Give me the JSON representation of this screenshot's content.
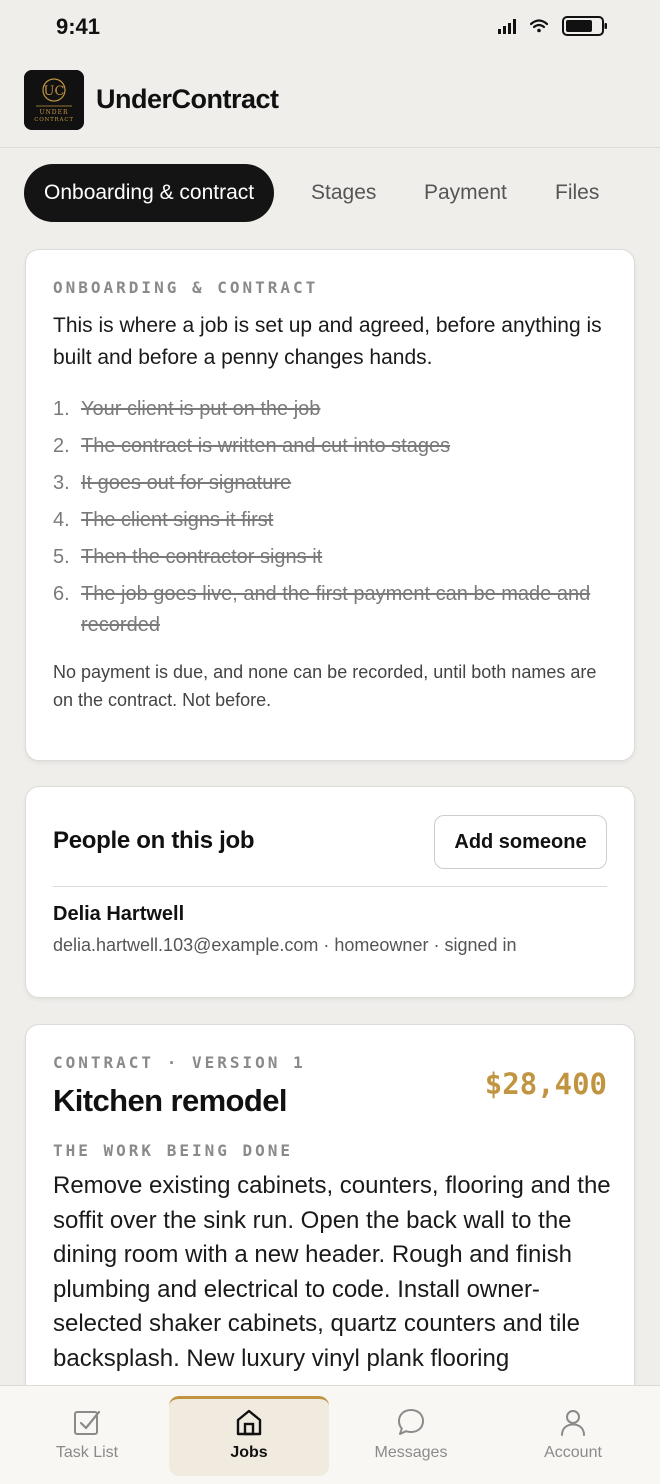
{
  "status": {
    "time": "9:41"
  },
  "app": {
    "title": "UnderContract",
    "logo_text": "UNDER CONTRACT"
  },
  "tabs": [
    {
      "label": "Onboarding & contract",
      "active": true
    },
    {
      "label": "Stages",
      "active": false
    },
    {
      "label": "Payment",
      "active": false
    },
    {
      "label": "Files",
      "active": false
    }
  ],
  "intro": {
    "eyebrow": "ONBOARDING & CONTRACT",
    "text": "This is where a job is set up and agreed, before anything is built and before a penny changes hands.",
    "steps": [
      {
        "num": "1.",
        "text": "Your client is put on the job",
        "done": true
      },
      {
        "num": "2.",
        "text": "The contract is written and cut into stages",
        "done": true
      },
      {
        "num": "3.",
        "text": "It goes out for signature",
        "done": true
      },
      {
        "num": "4.",
        "text": "The client signs it first",
        "done": true
      },
      {
        "num": "5.",
        "text": "Then the contractor signs it",
        "done": true
      },
      {
        "num": "6.",
        "text": "The job goes live, and the first payment can be made and recorded",
        "done": true
      }
    ],
    "note": "No payment is due, and none can be recorded, until both names are on the contract. Not before."
  },
  "people": {
    "title": "People on this job",
    "add_label": "Add someone",
    "members": [
      {
        "name": "Delia Hartwell",
        "meta": "delia.hartwell.103@example.com · homeowner · signed in"
      }
    ]
  },
  "contract": {
    "eyebrow": "CONTRACT · VERSION 1",
    "title": "Kitchen remodel",
    "amount": "$28,400",
    "work_eyebrow": "THE WORK BEING DONE",
    "description": "Remove existing cabinets, counters, flooring and the soffit over the sink run. Open the back wall to the dining room with a new header. Rough and finish plumbing and electrical to code. Install owner-selected shaker cabinets, quartz counters and tile backsplash. New luxury vinyl plank flooring"
  },
  "nav": [
    {
      "label": "Task List",
      "icon": "checkbox-icon",
      "active": false
    },
    {
      "label": "Jobs",
      "icon": "home-icon",
      "active": true
    },
    {
      "label": "Messages",
      "icon": "chat-bubble-icon",
      "active": false
    },
    {
      "label": "Account",
      "icon": "person-icon",
      "active": false
    }
  ],
  "colors": {
    "accent": "#c09440",
    "dark": "#141414",
    "background": "#efeeeb"
  }
}
